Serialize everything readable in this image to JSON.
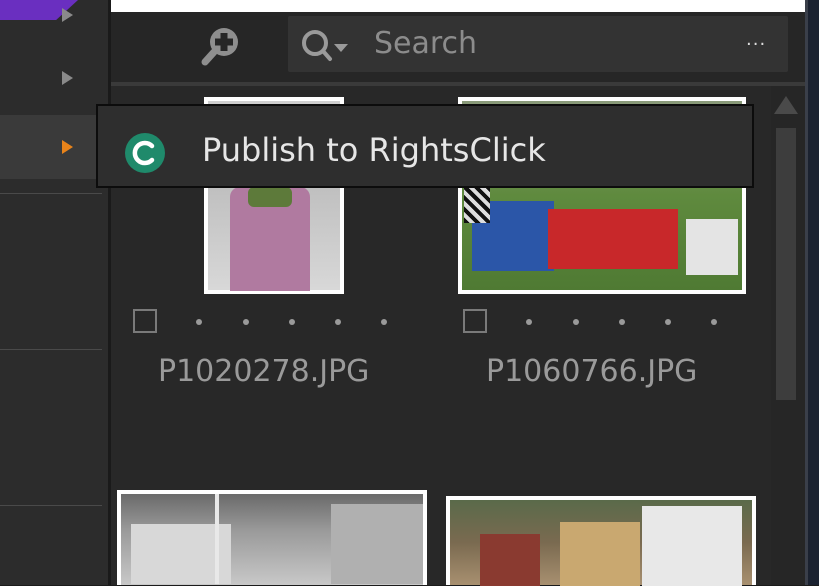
{
  "toolbar": {
    "search_placeholder": "Search",
    "more_label": "···"
  },
  "context_menu": {
    "item_label": "Publish to RightsClick",
    "item_icon": "rightsclick-logo-icon",
    "accent_color": "#1f8a6b"
  },
  "thumbnails": [
    {
      "filename": "P1020278.JPG",
      "checked": false
    },
    {
      "filename": "P1060766.JPG",
      "checked": false
    }
  ],
  "colors": {
    "submenu_arrow_active": "#e8831a",
    "brand_purple": "#6a2fc0"
  }
}
